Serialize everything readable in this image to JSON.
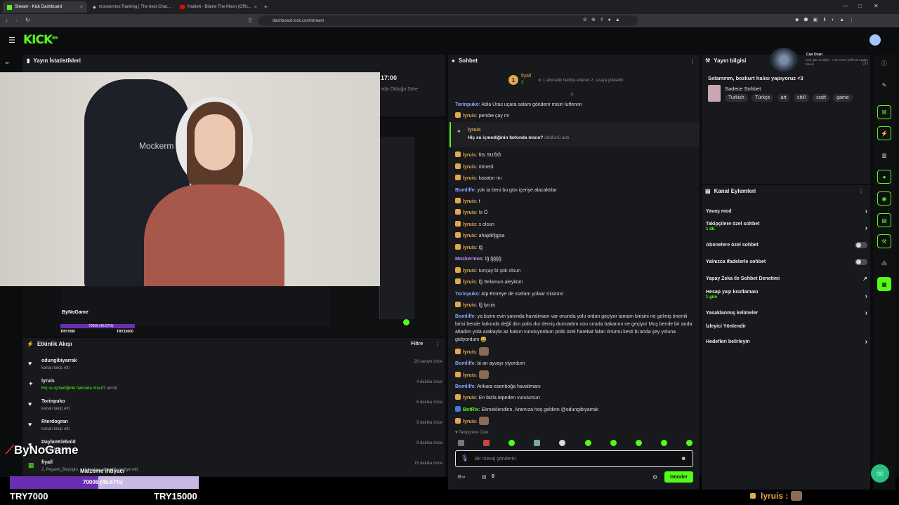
{
  "browser": {
    "tabs": [
      {
        "label": "Stream - Kick Dashboard"
      },
      {
        "label": "mockermos Ranking | The best Chat..."
      },
      {
        "label": "Hadiett - Blame The Moon (Offic..."
      }
    ],
    "url": "dashboard.kick.com/stream"
  },
  "app": {
    "logo": "KICK",
    "logo_sup": "BETA"
  },
  "stats": {
    "title": "Yayın İstatistikleri",
    "time": "17:00",
    "sub": "nda Olduğu Süre"
  },
  "video": {
    "chair_text": "Mockerm",
    "preview_name": "ByNoGame",
    "preview_goal": "70006 (46.67%)",
    "preview_left": "TRY7000",
    "preview_right": "TRY15000"
  },
  "activity": {
    "title": "Etkinlik Akışı",
    "filter": "Filtre",
    "items": [
      {
        "name": "odungibiyarrak",
        "desc": "kanalı takip etti",
        "time": "28 saniye önce",
        "icon": "♥"
      },
      {
        "name": "lyruis",
        "desc": "Hiç su içmediğinin farkında mısın?",
        "desc2": " alındı",
        "time": "4 dakika önce",
        "icon": "✦"
      },
      {
        "name": "Torinpuko",
        "desc": "kanalı takip etti",
        "time": "6 dakika önce",
        "icon": "♥"
      },
      {
        "name": "Rterdogran",
        "desc": "kanalı takip etti",
        "time": "9 dakika önce",
        "icon": "♥"
      },
      {
        "name": "DaylanKlebold",
        "desc": "kanalı takip etti",
        "time": "9 dakika önce",
        "icon": "♥"
      },
      {
        "name": "fiyall",
        "desc": "2, Peyami_Beyoglu, ... kanalıya abonelik hediye etti.",
        "time": "15 dakika önce",
        "icon": "▦"
      }
    ]
  },
  "overlay": {
    "brand": "ByNoGame",
    "goal_title": "Malzeme ihtiyacı",
    "goal_value": "70006 (46.67%)",
    "goal_progress": 0.4667,
    "left_amount": "TRY7000",
    "right_amount": "TRY15000",
    "bottom_user": "lyruis :"
  },
  "chat": {
    "title": "Sohbet",
    "pinned_user": "fiyall",
    "pinned_rank": "1",
    "pinned_count": "2",
    "pinned_text": "1 abonelik hediye ederek 2. sıraya yükselin",
    "highlight_user": "lyruis",
    "highlight_text": "Hiç su içmediğinin farkında mısın?",
    "highlight_suffix": " ödülünü aldı",
    "messages": [
      {
        "user": "Torinpuko",
        "text": "Abla Uras uçara selam gönderir misin lutfennn",
        "color": "#8aa7ff",
        "badge": false
      },
      {
        "user": "lyruis",
        "text": "pembe çay mı",
        "color": "#e0a84f",
        "badge": true
      },
      {
        "user": "lyruis",
        "text": "ftts SUĞĞ",
        "color": "#e0a84f",
        "badge": true
      },
      {
        "user": "lyruis",
        "text": "ötmedi",
        "color": "#e0a84f",
        "badge": true
      },
      {
        "user": "lyruis",
        "text": "kaoatın mı",
        "color": "#e0a84f",
        "badge": true
      },
      {
        "user": "Bomlilfe",
        "text": "yok ta beni bu gün içeriye alacaktılar",
        "color": "#8aa7ff",
        "badge": false
      },
      {
        "user": "lyruis",
        "text": "t",
        "color": "#e0a84f",
        "badge": true
      },
      {
        "user": "lyruis",
        "text": "!s Ö",
        "color": "#e0a84f",
        "badge": true
      },
      {
        "user": "lyruis",
        "text": "s olsun",
        "color": "#e0a84f",
        "badge": true
      },
      {
        "user": "lyruis",
        "text": "ahajdkfjgjsa",
        "color": "#e0a84f",
        "badge": true
      },
      {
        "user": "lyruis",
        "text": "lğ",
        "color": "#e0a84f",
        "badge": true
      },
      {
        "user": "Mockermos",
        "text": "lğ ğğğğ",
        "color": "#c48cff",
        "badge": false
      },
      {
        "user": "lyruis",
        "text": "tunçay bi şok olsun",
        "color": "#e0a84f",
        "badge": true
      },
      {
        "user": "lyruis",
        "text": "lğ Selamun aleyküm",
        "color": "#e0a84f",
        "badge": true
      },
      {
        "user": "Torinpuko",
        "text": "Alp Emreye de sselam yolaar misinnn",
        "color": "#8aa7ff",
        "badge": false
      },
      {
        "user": "lyruis",
        "text": "lğ lyruis",
        "color": "#e0a84f",
        "badge": true
      }
    ],
    "long_user": "Bomlilfe",
    "long_text": "ya bizim evin yanında havalimanı var onunda yolu ordan geçiyor tamam birisini ne gelmiş önemli birisi bende farkında değil dim polis dur demiş durmadım ooo sırada bakanını ne geçiyor Muş bende bir anda altadım yola arabayla az kalsın vuruluyordum polis özel harekat falan önümü kesti bi anda şey yoluna gidiyordum 😅",
    "messages2": [
      {
        "user": "lyruis",
        "text": "",
        "color": "#e0a84f",
        "badge": true,
        "emote": true
      },
      {
        "user": "Bomlilfe",
        "text": "bi an ayvayı yiyordum",
        "color": "#8aa7ff",
        "badge": false
      },
      {
        "user": "lyruis",
        "text": "",
        "color": "#e0a84f",
        "badge": true,
        "emote": true
      },
      {
        "user": "Bomlilfe",
        "text": "Ankara esenboğa havalimanı",
        "color": "#8aa7ff",
        "badge": false
      },
      {
        "user": "lyruis",
        "text": "En fazla tepeden vurulursun",
        "color": "#e0a84f",
        "badge": true
      },
      {
        "user": "BotRix",
        "text": "Ekmeklendinn, Aramıza hoş geldinn @odungibiyarrak",
        "color": "#53fc18",
        "badge": false
      },
      {
        "user": "lyruis",
        "text": "",
        "color": "#e0a84f",
        "badge": true,
        "emote": true
      }
    ],
    "followers_only": "Takipçilere Özel",
    "input_placeholder": "Bir mesaj gönderin",
    "send": "Gönder",
    "viewer_count": "0"
  },
  "stream_info": {
    "title": "Yayın bilgisi",
    "music_user": "Can Ozan",
    "music_title": "Artık gitti sevdiğin - Can Ozan (Official Music Video)",
    "stream_title": "Selammm, bozkurt halısı yapıyoruz <3",
    "category": "Sadece Sohbet",
    "tags": [
      "Turkish",
      "Türkçe",
      "art",
      "chill",
      "craft",
      "game"
    ]
  },
  "channel_actions": {
    "title": "Kanal Eylemleri",
    "items": [
      {
        "label": "Yavaş mod",
        "sub": "",
        "control": "chevron"
      },
      {
        "label": "Takipçilere özel sohbet",
        "sub": "1 dk.",
        "control": "chevron"
      },
      {
        "label": "Abonelere özel sohbet",
        "sub": "",
        "control": "toggle"
      },
      {
        "label": "Yalnızca ifadelerle sohbet",
        "sub": "",
        "control": "toggle"
      },
      {
        "label": "Yapay Zeka ile Sohbet Denetimi",
        "sub": "",
        "control": "external"
      },
      {
        "label": "Hesap yaşı kısıtlaması",
        "sub": "1 gün",
        "control": "chevron"
      },
      {
        "label": "Yasaklanmış kelimeler",
        "sub": "",
        "control": "chevron"
      },
      {
        "label": "İzleyici Yönlendir",
        "sub": "",
        "control": "none"
      },
      {
        "label": "Hedefleri belirleyin",
        "sub": "",
        "control": "chevron"
      }
    ]
  },
  "colors": {
    "accent": "#53fc18",
    "panel": "#18191c",
    "background": "#0b0c0e"
  }
}
